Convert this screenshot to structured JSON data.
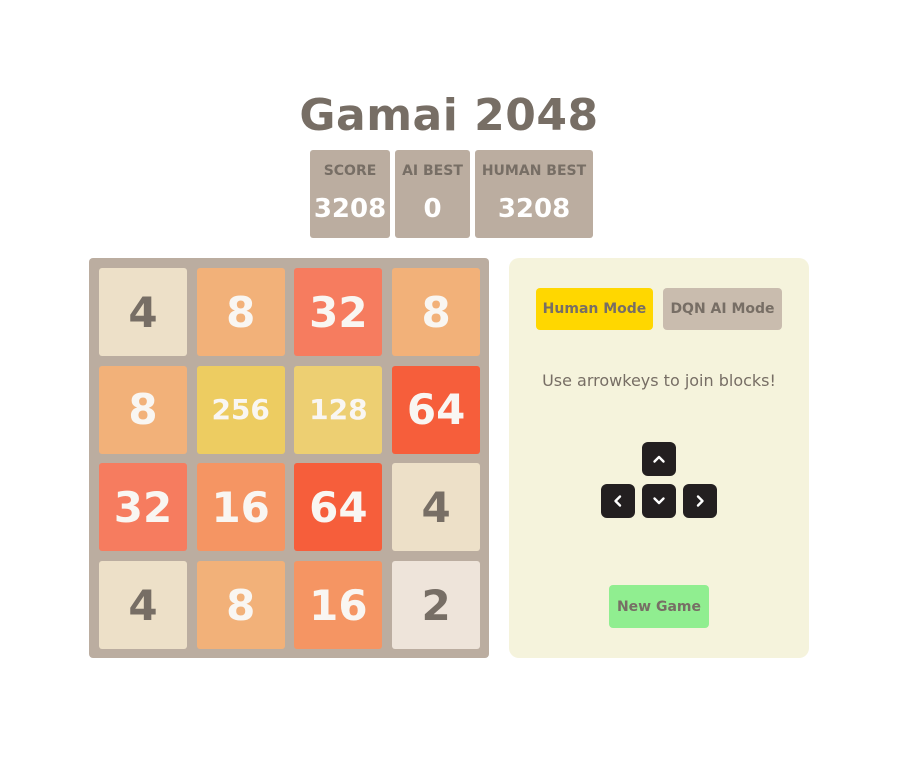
{
  "title": "Gamai 2048",
  "scores": {
    "score": {
      "label": "SCORE",
      "value": "3208"
    },
    "ai_best": {
      "label": "AI BEST",
      "value": "0"
    },
    "human_best": {
      "label": "HUMAN BEST",
      "value": "3208"
    }
  },
  "board": {
    "rows": [
      [
        "4",
        "8",
        "32",
        "8"
      ],
      [
        "8",
        "256",
        "128",
        "64"
      ],
      [
        "32",
        "16",
        "64",
        "4"
      ],
      [
        "4",
        "8",
        "16",
        "2"
      ]
    ]
  },
  "tile_colors": {
    "2": {
      "bg": "#eee4da",
      "fg": "#776e65"
    },
    "4": {
      "bg": "#ede0c8",
      "fg": "#776e65"
    },
    "8": {
      "bg": "#f2b179",
      "fg": "#f9f6f2"
    },
    "16": {
      "bg": "#f59563",
      "fg": "#f9f6f2"
    },
    "32": {
      "bg": "#f67c5f",
      "fg": "#f9f6f2"
    },
    "64": {
      "bg": "#f65e3b",
      "fg": "#f9f6f2"
    },
    "128": {
      "bg": "#edcf72",
      "fg": "#f9f6f2"
    },
    "256": {
      "bg": "#edcc61",
      "fg": "#f9f6f2"
    }
  },
  "panel": {
    "human_mode_label": "Human Mode",
    "ai_mode_label": "DQN AI Mode",
    "instructions": "Use arrowkeys to join blocks!",
    "keys": {
      "up": "chevron-up-icon",
      "left": "chevron-left-icon",
      "down": "chevron-down-icon",
      "right": "chevron-right-icon"
    },
    "new_game_label": "New Game"
  },
  "colors": {
    "human_mode_active": "#ffd700",
    "ai_mode_inactive": "#c9bcae",
    "new_game": "#90ee90",
    "panel_bg": "#f5f3dc",
    "board_bg": "#bbada0"
  }
}
